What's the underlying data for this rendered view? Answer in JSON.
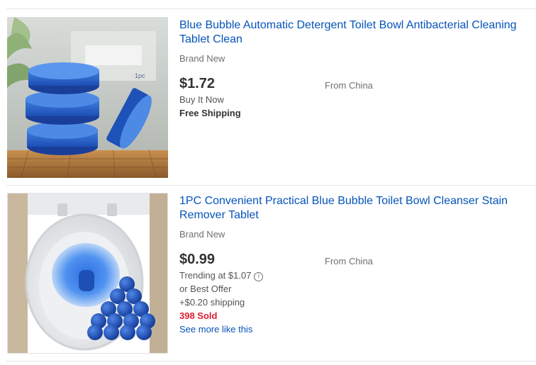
{
  "listings": [
    {
      "title": "Blue Bubble Automatic Detergent Toilet Bowl Antibacterial Cleaning Tablet Clean",
      "condition": "Brand New",
      "price": "$1.72",
      "origin": "From China",
      "format": "Buy It Now",
      "shipping": "Free Shipping",
      "image_label": "1pc",
      "image": "blue-toilet-tablets-stack"
    },
    {
      "title": "1PC Convenient Practical Blue Bubble Toilet Bowl Cleanser Stain Remover Tablet",
      "condition": "Brand New",
      "price": "$0.99",
      "origin": "From China",
      "trending": "Trending at $1.07",
      "best_offer": "or Best Offer",
      "shipping": "+$0.20 shipping",
      "sold": "398 Sold",
      "see_more": "See more like this",
      "image": "toilet-with-blue-tablets"
    }
  ],
  "colors": {
    "link": "#0654ba",
    "sold": "#dd1e31",
    "price": "#333333",
    "muted": "#707070"
  },
  "icons": {
    "trending_info": "info-icon"
  }
}
